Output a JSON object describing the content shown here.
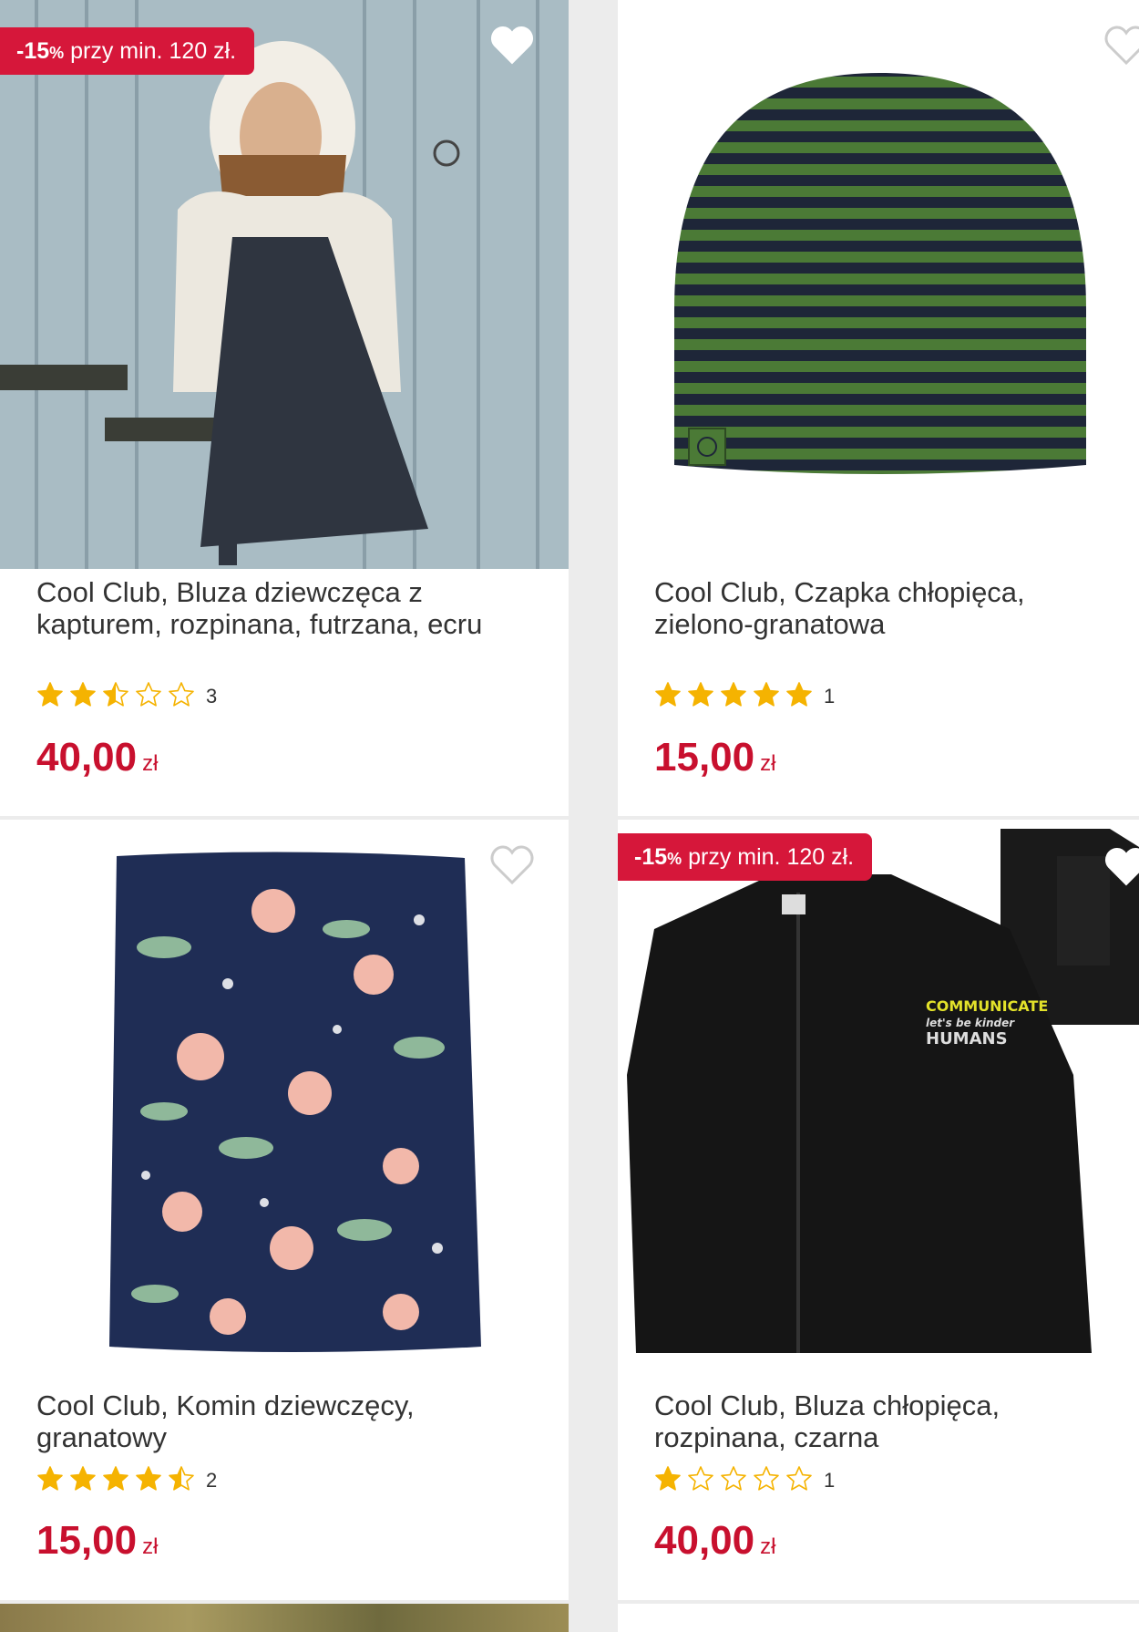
{
  "colors": {
    "accent": "#c8102e",
    "badge": "#d6173a",
    "star": "#f5b301"
  },
  "icons": {
    "wishlist": "heart-icon",
    "rating": "star-icon"
  },
  "products": [
    {
      "badge": {
        "bold": "-15",
        "pct": "%",
        "text": " przy min. 120 zł."
      },
      "title": "Cool Club, Bluza dziewczęca z kapturem, rozpinana, futrzana, ecru",
      "rating": 2.5,
      "reviews": "3",
      "price": "40,00",
      "currency": "zł",
      "wishlist_filled": true
    },
    {
      "title": "Cool Club, Czapka chłopięca, zielono-granatowa",
      "rating": 5,
      "reviews": "1",
      "price": "15,00",
      "currency": "zł",
      "wishlist_filled": false
    },
    {
      "title": "Cool Club, Komin dziewczęcy, granatowy",
      "rating": 4.5,
      "reviews": "2",
      "price": "15,00",
      "currency": "zł",
      "wishlist_filled": false
    },
    {
      "badge": {
        "bold": "-15",
        "pct": "%",
        "text": " przy min. 120 zł."
      },
      "title": "Cool Club, Bluza chłopięca, rozpinana, czarna",
      "rating": 1,
      "reviews": "1",
      "price": "40,00",
      "currency": "zł",
      "wishlist_filled": true,
      "image_text": [
        "COMMUNICATE",
        "let's be kinder",
        "HUMANS"
      ]
    }
  ]
}
